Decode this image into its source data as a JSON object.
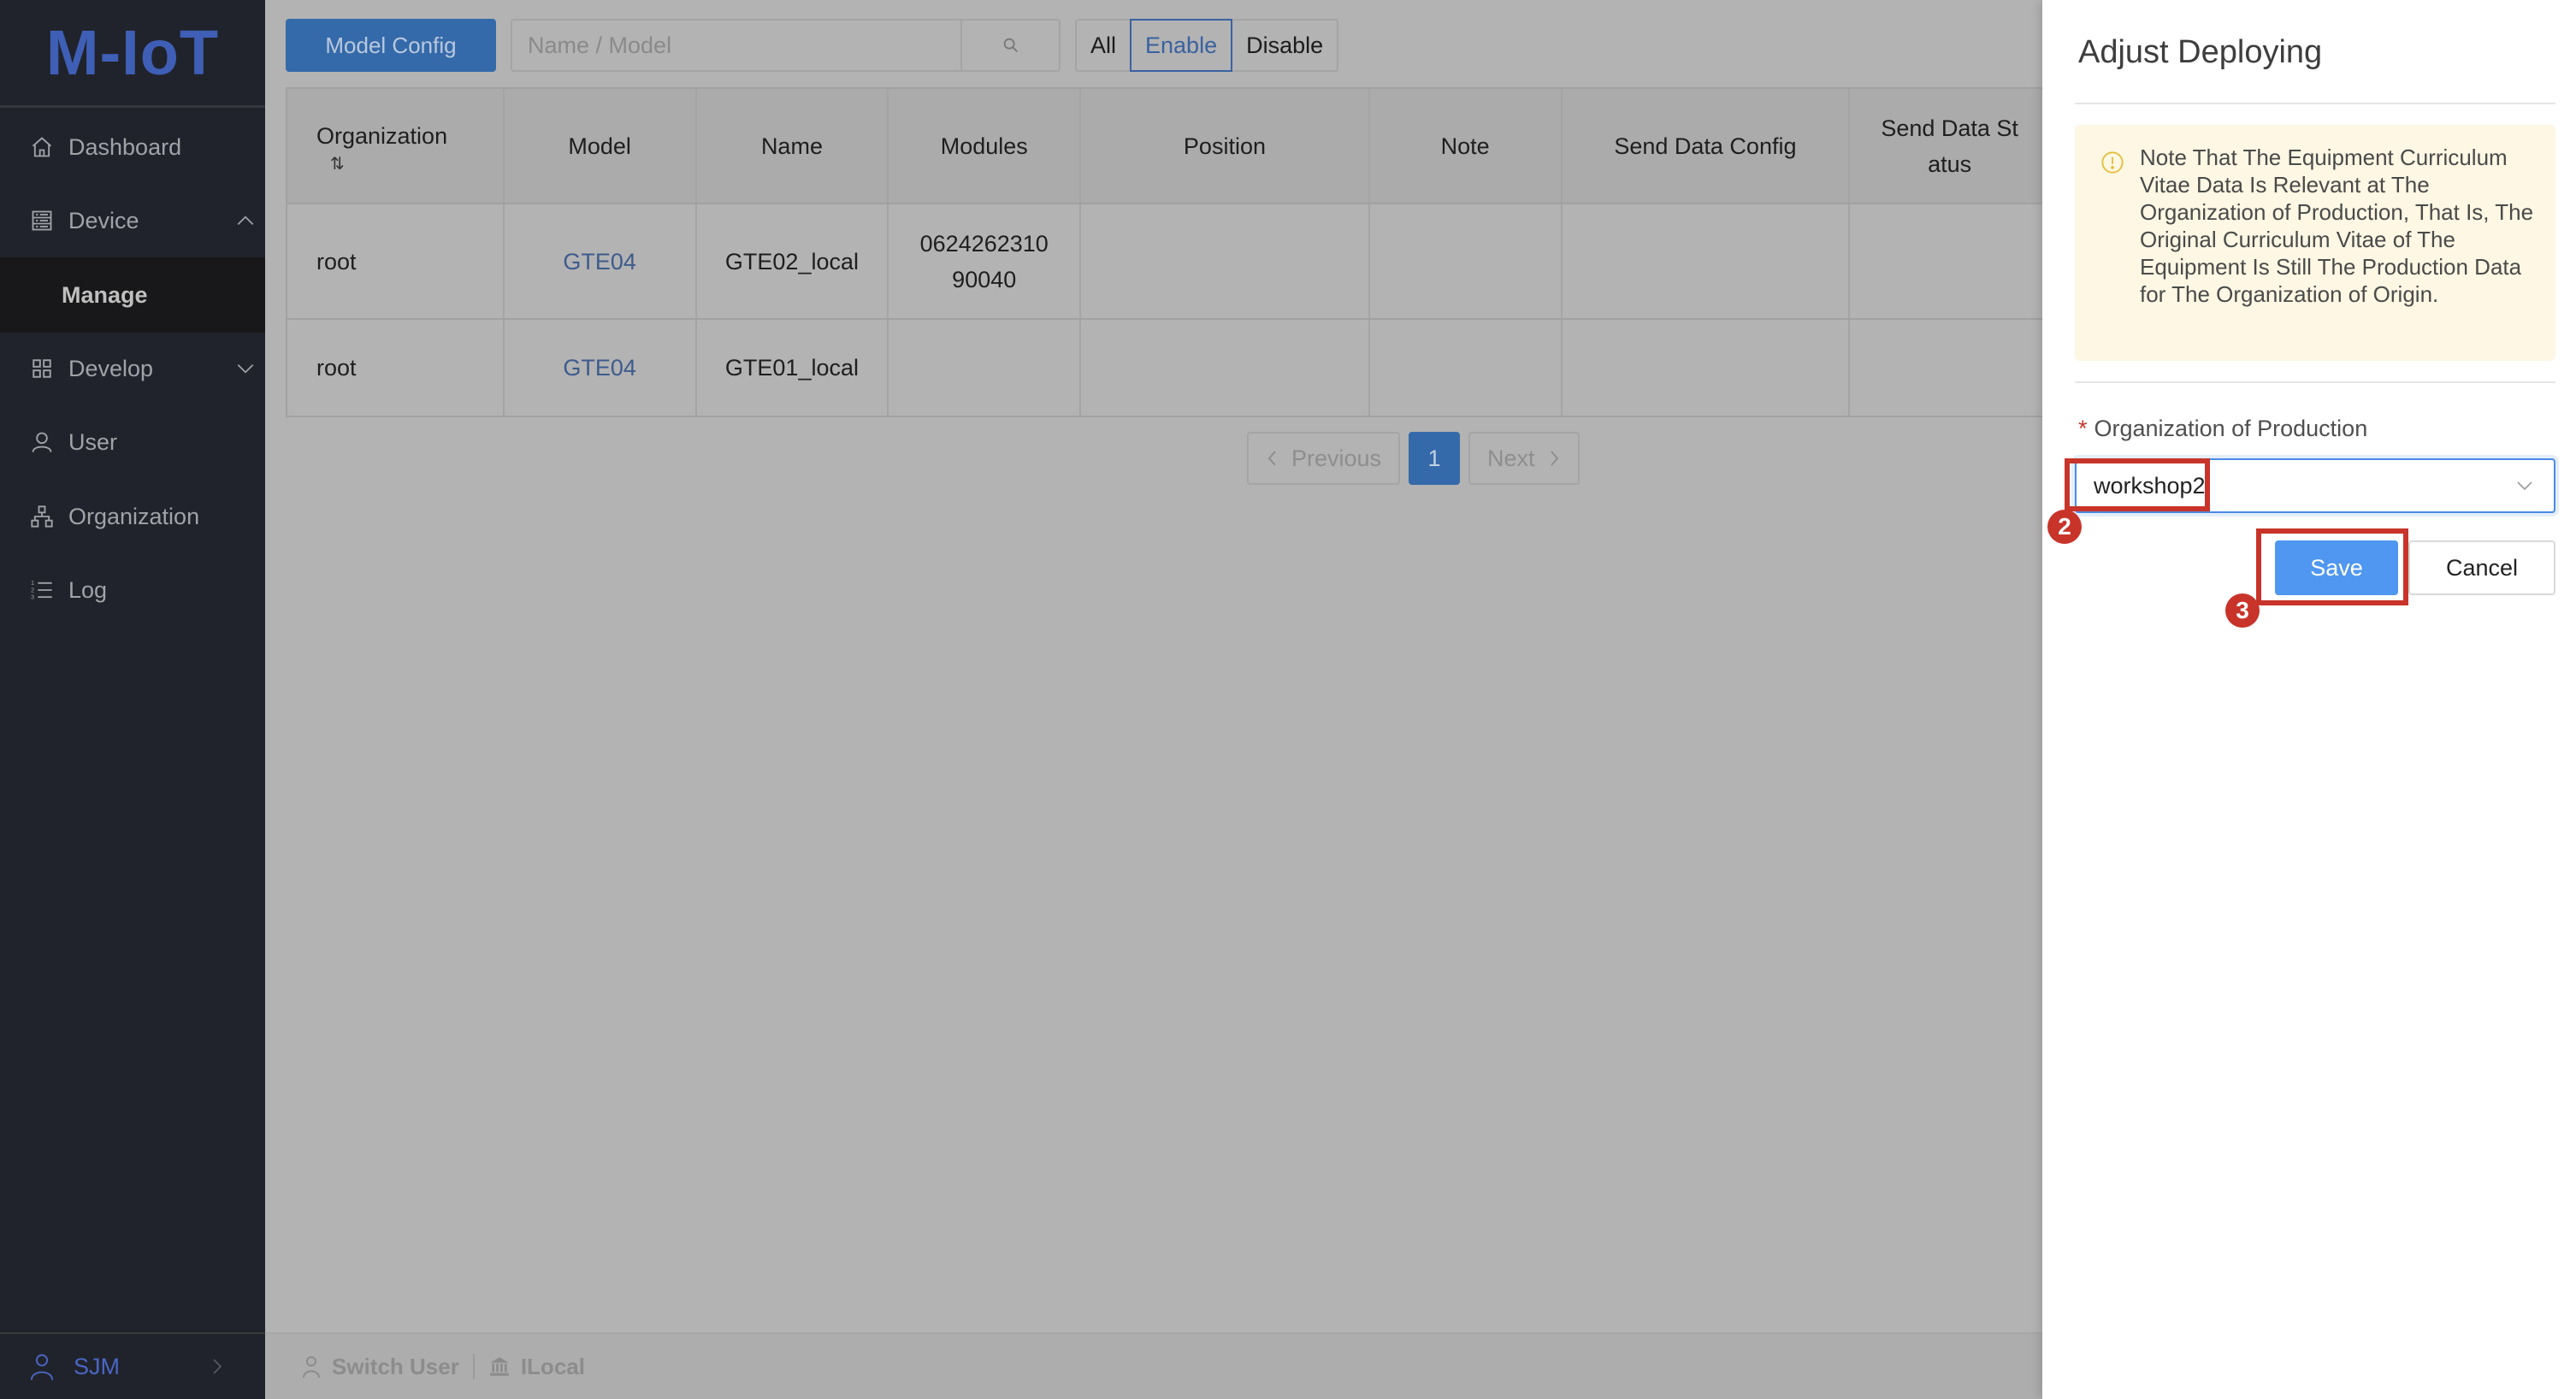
{
  "app": {
    "logo": "M-IoT",
    "brand_color": "#3f5fb6",
    "primary_color": "#356aaa"
  },
  "sidebar": {
    "items": [
      {
        "label": "Dashboard",
        "icon": "home-icon"
      },
      {
        "label": "Device",
        "icon": "server-icon",
        "expanded": true
      },
      {
        "label": "Manage",
        "sub": true,
        "active": true
      },
      {
        "label": "Develop",
        "icon": "grid-icon",
        "expanded": false
      },
      {
        "label": "User",
        "icon": "user-icon"
      },
      {
        "label": "Organization",
        "icon": "org-tree-icon"
      },
      {
        "label": "Log",
        "icon": "ordered-list-icon"
      }
    ],
    "footer": {
      "user": "SJM",
      "icon": "user-icon"
    }
  },
  "toolbar": {
    "model_config_label": "Model Config",
    "search_placeholder": "Name / Model",
    "search_value": "",
    "filters": [
      "All",
      "Enable",
      "Disable"
    ],
    "active_filter": "Enable"
  },
  "table": {
    "columns": [
      "Organization",
      "Model",
      "Name",
      "Modules",
      "Position",
      "Note",
      "Send Data Config",
      "Send Data St\natus"
    ],
    "sort_icon": "⇅",
    "rows": [
      {
        "organization": "root",
        "model": "GTE04",
        "name": "GTE02_local",
        "modules": "0624262310\n90040",
        "position": "",
        "note": "",
        "send_data_config": "",
        "send_data_status": ""
      },
      {
        "organization": "root",
        "model": "GTE04",
        "name": "GTE01_local",
        "modules": "",
        "position": "",
        "note": "",
        "send_data_config": "",
        "send_data_status": ""
      }
    ]
  },
  "pagination": {
    "previous": "Previous",
    "current": "1",
    "next": "Next"
  },
  "bottom_bar": {
    "switch_user": "Switch User",
    "org": "ILocal"
  },
  "drawer": {
    "title": "Adjust Deploying",
    "alert": "Note That The Equipment Curriculum Vitae Data Is Relevant at The Organization of Production, That Is, The Original Curriculum Vitae of The Equipment Is Still The Production Data for The Organization of Origin.",
    "field_label": "Organization of Production",
    "required_mark": "*",
    "selected_value": "workshop2",
    "save_label": "Save",
    "cancel_label": "Cancel"
  },
  "annotations": [
    {
      "number": "2",
      "target": "organization-select"
    },
    {
      "number": "3",
      "target": "save-button"
    }
  ]
}
